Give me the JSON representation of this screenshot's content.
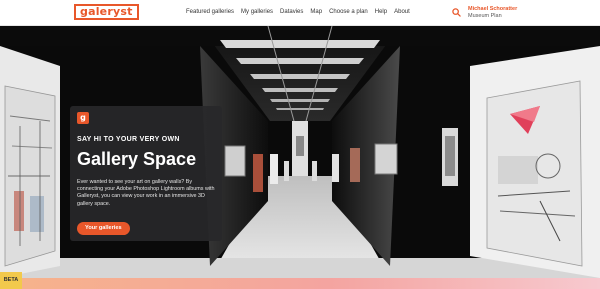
{
  "header": {
    "logo_text": "galeryst",
    "nav": [
      {
        "label": "Featured galleries"
      },
      {
        "label": "My galleries"
      },
      {
        "label": "Datavies"
      },
      {
        "label": "Map"
      },
      {
        "label": "Choose a plan"
      },
      {
        "label": "Help"
      },
      {
        "label": "About"
      }
    ],
    "search_icon": "search-icon",
    "user": {
      "name": "Michael Schoratter",
      "plan": "Museum Plan"
    }
  },
  "hero": {
    "logo_letter": "g",
    "eyebrow": "SAY HI TO YOUR VERY OWN",
    "title": "Gallery Space",
    "body": "Ever wanted to see your art on gallery walls? By connecting your Adobe Photoshop Lightroom albums with Galleryst, you can view your work in an immersive 3D gallery space.",
    "button_label": "Your galleries"
  },
  "badge": {
    "label": "BETA"
  },
  "colors": {
    "accent": "#e8572a",
    "card_bg": "#28282a"
  }
}
